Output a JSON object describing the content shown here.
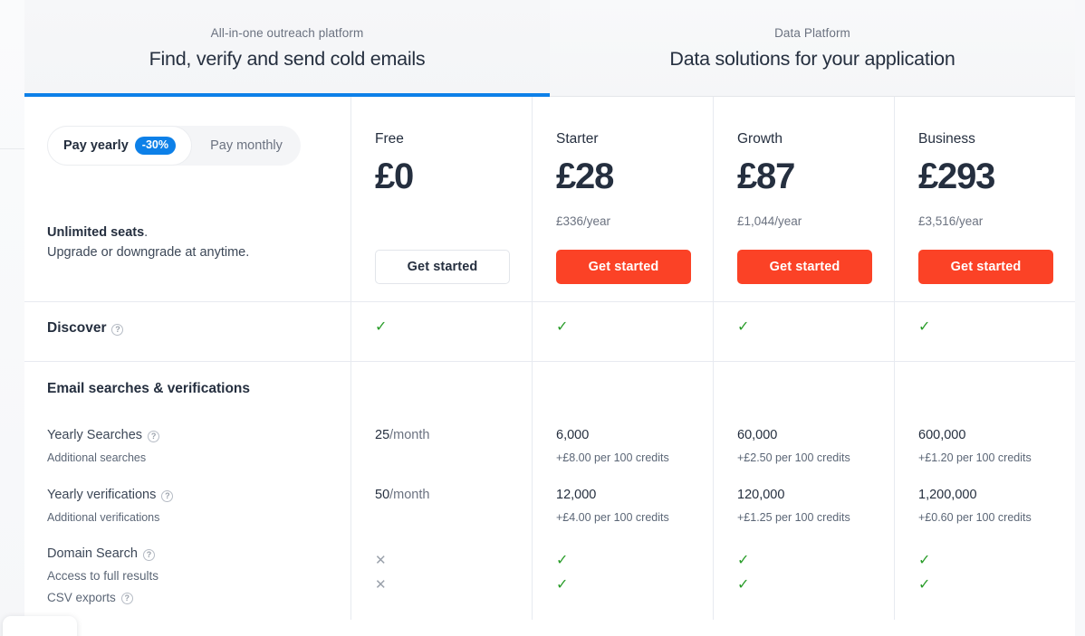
{
  "tabs": [
    {
      "eyebrow": "All-in-one outreach platform",
      "title": "Find, verify and send cold emails",
      "active": true
    },
    {
      "eyebrow": "Data Platform",
      "title": "Data solutions for your application",
      "active": false
    }
  ],
  "billing_toggle": {
    "yearly_label": "Pay yearly",
    "discount_badge": "-30%",
    "monthly_label": "Pay monthly",
    "selected": "Pay yearly"
  },
  "seats_note": {
    "strong": "Unlimited seats",
    "period": ".",
    "rest": "Upgrade or downgrade at anytime."
  },
  "plans": [
    {
      "name": "Free",
      "price": "£0",
      "yearly": "",
      "cta": "Get started",
      "cta_style": "outline"
    },
    {
      "name": "Starter",
      "price": "£28",
      "yearly": "£336/year",
      "cta": "Get started",
      "cta_style": "primary"
    },
    {
      "name": "Growth",
      "price": "£87",
      "yearly": "£1,044/year",
      "cta": "Get started",
      "cta_style": "primary"
    },
    {
      "name": "Business",
      "price": "£293",
      "yearly": "£3,516/year",
      "cta": "Get started",
      "cta_style": "primary"
    }
  ],
  "discover_row": {
    "label": "Discover",
    "help": "?",
    "marks": [
      "check",
      "check",
      "check",
      "check"
    ]
  },
  "section_email": {
    "title": "Email searches & verifications"
  },
  "features": [
    {
      "name": "Yearly Searches",
      "help": "?",
      "sub": "Additional searches",
      "values": [
        {
          "num": "25",
          "unit": "/month",
          "sub": ""
        },
        {
          "num": "6,000",
          "unit": "",
          "sub": "+£8.00 per 100 credits"
        },
        {
          "num": "60,000",
          "unit": "",
          "sub": "+£2.50 per 100 credits"
        },
        {
          "num": "600,000",
          "unit": "",
          "sub": "+£1.20 per 100 credits"
        }
      ]
    },
    {
      "name": "Yearly verifications",
      "help": "?",
      "sub": "Additional verifications",
      "values": [
        {
          "num": "50",
          "unit": "/month",
          "sub": ""
        },
        {
          "num": "12,000",
          "unit": "",
          "sub": "+£4.00 per 100 credits"
        },
        {
          "num": "120,000",
          "unit": "",
          "sub": "+£1.25 per 100 credits"
        },
        {
          "num": "1,200,000",
          "unit": "",
          "sub": "+£0.60 per 100 credits"
        }
      ]
    }
  ],
  "domain_search": {
    "title": "Domain Search",
    "title_help": "?",
    "sub_rows": [
      {
        "label": "Access to full results",
        "help": "",
        "marks": [
          "cross",
          "check",
          "check",
          "check"
        ]
      },
      {
        "label": "CSV exports",
        "help": "?",
        "marks": [
          "cross",
          "check",
          "check",
          "check"
        ]
      }
    ]
  },
  "glyphs": {
    "check": "✓",
    "cross": "✕"
  },
  "colors": {
    "accent_blue": "#0d80e8",
    "cta_orange": "#fb4226",
    "check_green": "#2a9d2a",
    "text_dark": "#252f3f",
    "text_muted": "#6b7280"
  }
}
